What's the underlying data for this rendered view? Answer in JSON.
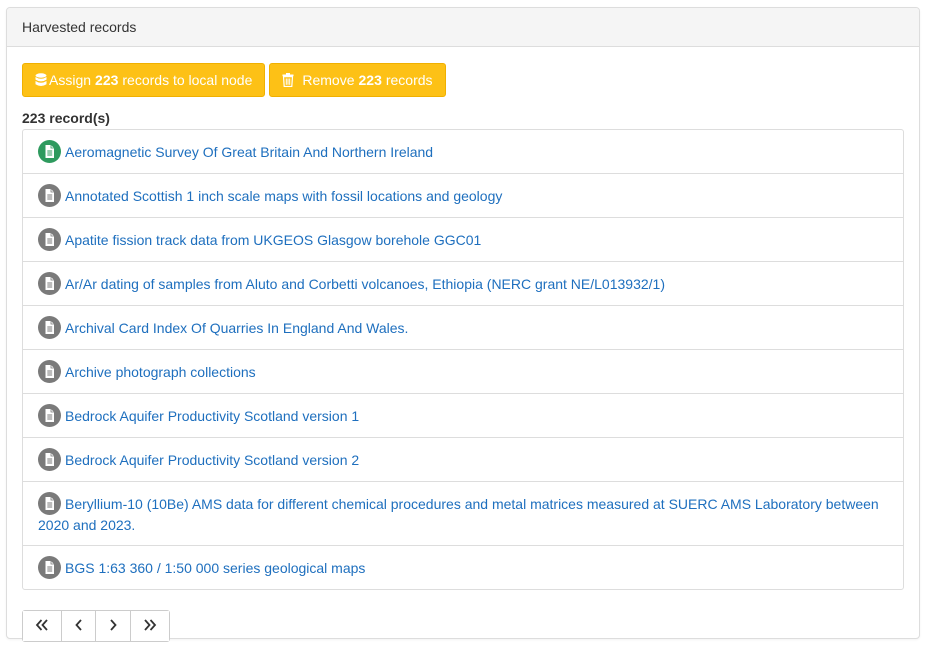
{
  "panel": {
    "title": "Harvested records"
  },
  "actions": {
    "assign": {
      "prefix": "Assign",
      "count": "223",
      "suffix": "records to local node",
      "icon": "database-icon"
    },
    "remove": {
      "prefix": "Remove",
      "count": "223",
      "suffix": "records",
      "icon": "trash-icon"
    },
    "color": "#fdc116"
  },
  "record_count": "223 record(s)",
  "records": [
    {
      "title": "Aeromagnetic Survey Of Great Britain And Northern Ireland",
      "icon": "document-icon",
      "status": "green"
    },
    {
      "title": "Annotated Scottish 1 inch scale maps with fossil locations and geology",
      "icon": "document-icon",
      "status": "grey"
    },
    {
      "title": "Apatite fission track data from UKGEOS Glasgow borehole GGC01",
      "icon": "document-icon",
      "status": "grey"
    },
    {
      "title": "Ar/Ar dating of samples from Aluto and Corbetti volcanoes, Ethiopia (NERC grant NE/L013932/1)",
      "icon": "document-icon",
      "status": "grey"
    },
    {
      "title": "Archival Card Index Of Quarries In England And Wales.",
      "icon": "document-icon",
      "status": "grey"
    },
    {
      "title": "Archive photograph collections",
      "icon": "document-icon",
      "status": "grey"
    },
    {
      "title": "Bedrock Aquifer Productivity Scotland version 1",
      "icon": "document-icon",
      "status": "grey"
    },
    {
      "title": "Bedrock Aquifer Productivity Scotland version 2",
      "icon": "document-icon",
      "status": "grey"
    },
    {
      "title": "Beryllium-10 (10Be) AMS data for different chemical procedures and metal matrices measured at SUERC AMS Laboratory between 2020 and 2023.",
      "icon": "document-icon",
      "status": "grey"
    },
    {
      "title": "BGS 1:63 360 / 1:50 000 series geological maps",
      "icon": "document-icon",
      "status": "grey"
    }
  ],
  "status_colors": {
    "green": "#2e9a5e",
    "grey": "#7a7a7a"
  },
  "link_color": "#1e6fbe",
  "pagination": {
    "first_icon": "double-chevron-left-icon",
    "prev_icon": "chevron-left-icon",
    "next_icon": "chevron-right-icon",
    "last_icon": "double-chevron-right-icon"
  }
}
